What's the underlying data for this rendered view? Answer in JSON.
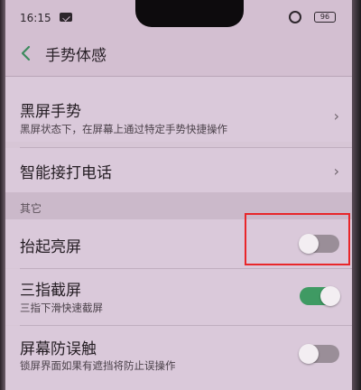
{
  "status_bar": {
    "time": "16:15",
    "battery": "96"
  },
  "nav": {
    "title": "手势体感"
  },
  "rows": [
    {
      "title": "黑屏手势",
      "subtitle": "黑屏状态下，在屏幕上通过特定手势快捷操作",
      "control": "chevron"
    },
    {
      "title": "智能接打电话",
      "subtitle": "",
      "control": "chevron"
    },
    {
      "title": "抬起亮屏",
      "subtitle": "",
      "control": "toggle",
      "enabled": false
    },
    {
      "title": "三指截屏",
      "subtitle": "三指下滑快速截屏",
      "control": "toggle",
      "enabled": true
    },
    {
      "title": "屏幕防误触",
      "subtitle": "锁屏界面如果有遮挡将防止误操作",
      "control": "toggle",
      "enabled": false
    }
  ],
  "section": {
    "other_label": "其它"
  },
  "icons": {
    "back": "chevron-left-icon",
    "chevron": "chevron-right-icon"
  },
  "colors": {
    "accent_green": "#3f9a63",
    "highlight_red": "#e8262a",
    "background": "#d7c6d6"
  }
}
